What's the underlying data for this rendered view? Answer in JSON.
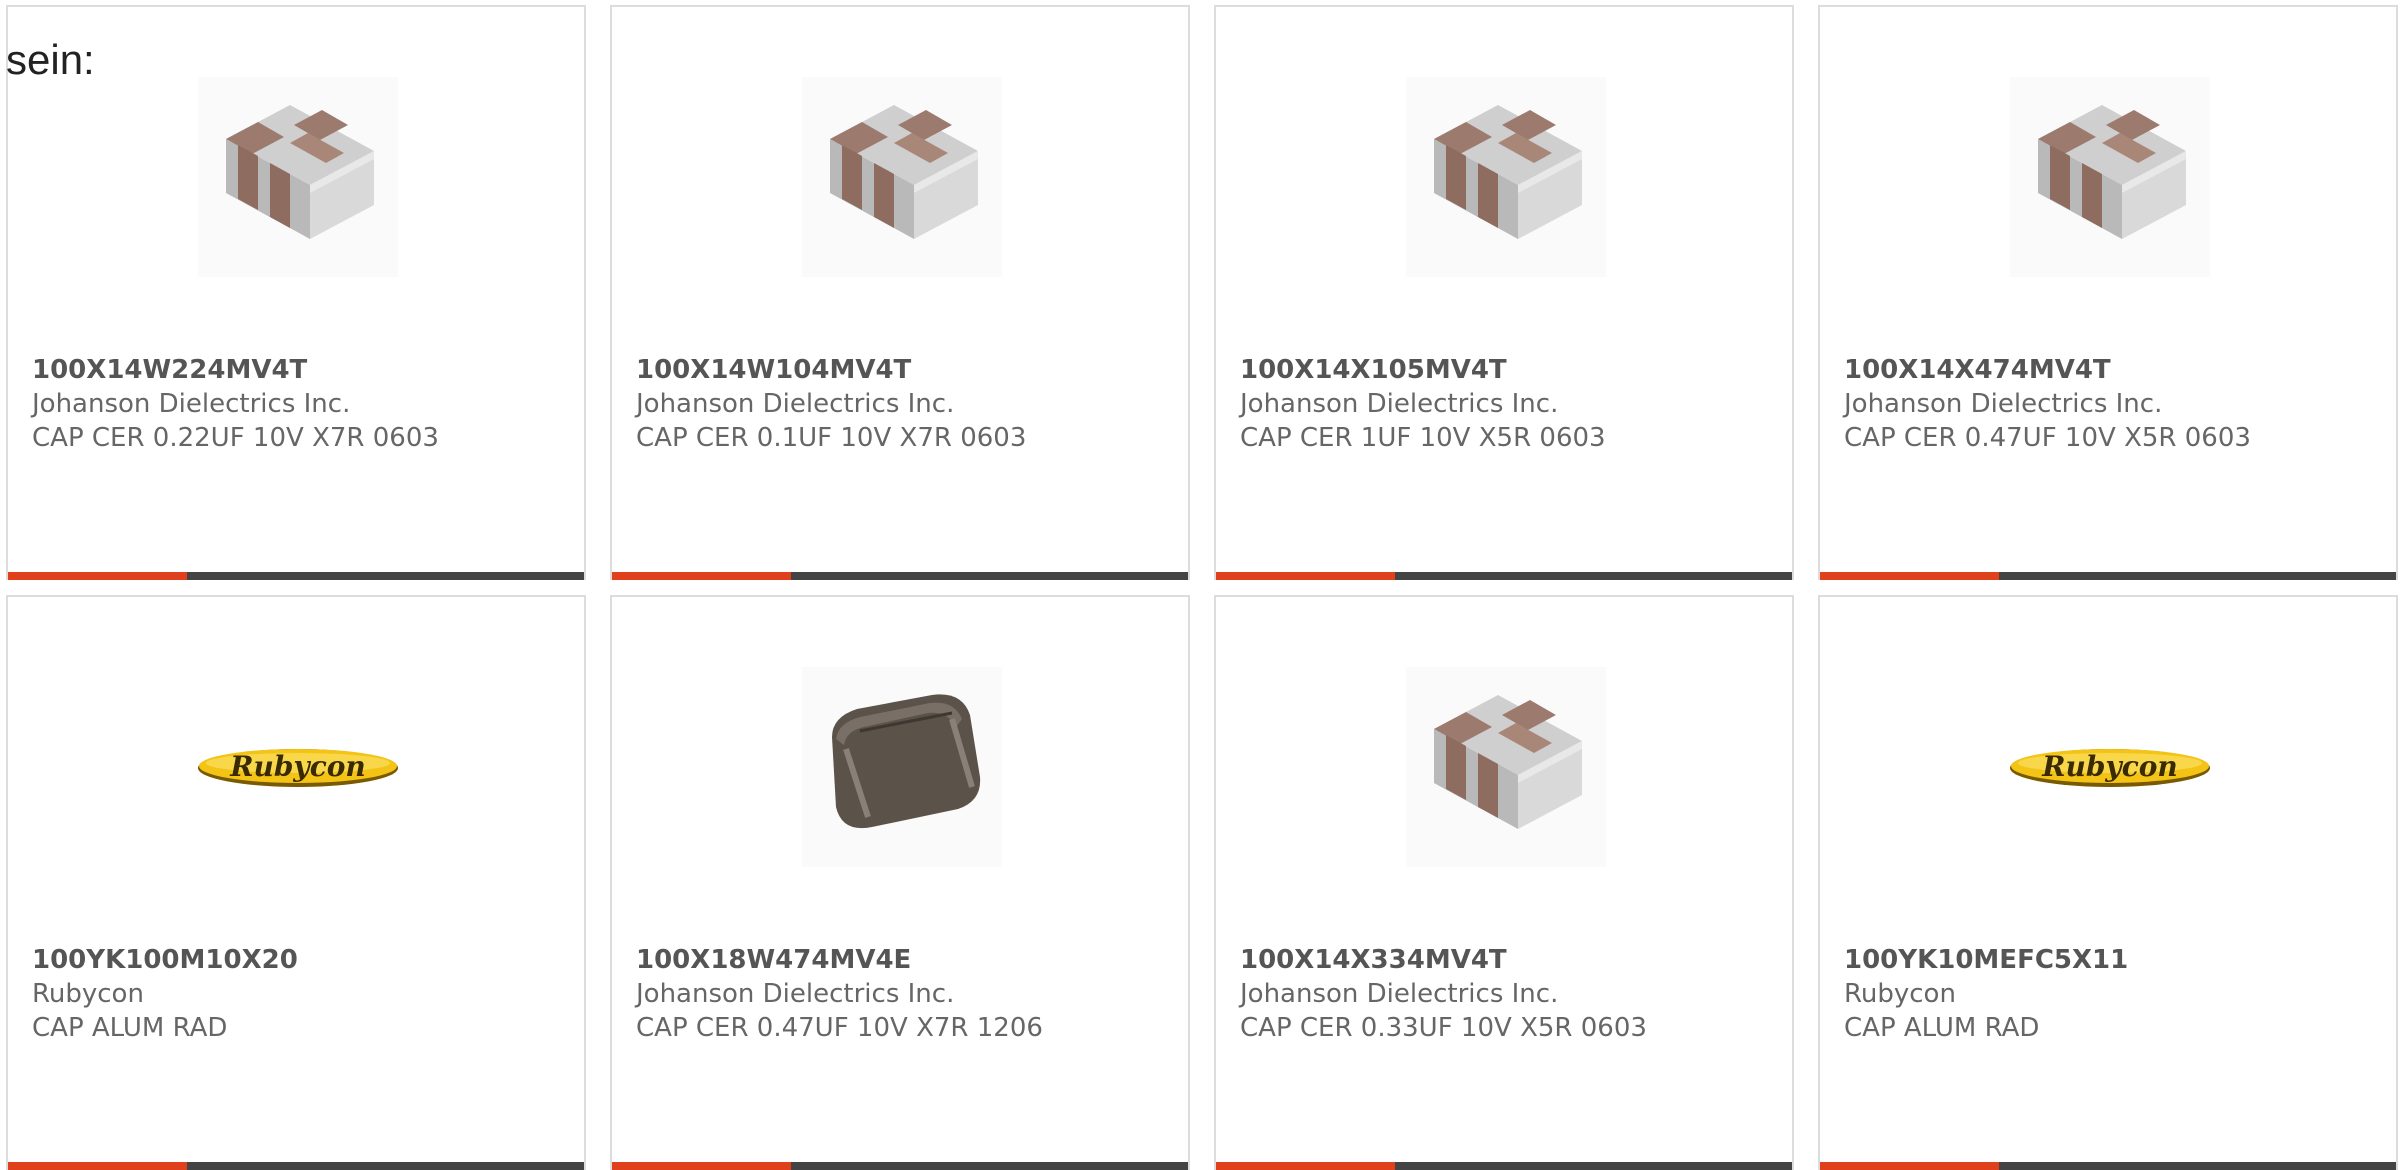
{
  "intro_text": "sein:",
  "colors": {
    "accent": "#e0401c",
    "bar_dark": "#444444",
    "card_border": "#dcdcdc"
  },
  "products": [
    {
      "part": "100X14W224MV4T",
      "manufacturer": "Johanson Dielectrics Inc.",
      "description": "CAP CER 0.22UF 10V X7R 0603",
      "image": "ceramic-chip-capacitor-icon",
      "accent_fraction": 0.31
    },
    {
      "part": "100X14W104MV4T",
      "manufacturer": "Johanson Dielectrics Inc.",
      "description": "CAP CER 0.1UF 10V X7R 0603",
      "image": "ceramic-chip-capacitor-icon",
      "accent_fraction": 0.31
    },
    {
      "part": "100X14X105MV4T",
      "manufacturer": "Johanson Dielectrics Inc.",
      "description": "CAP CER 1UF 10V X5R 0603",
      "image": "ceramic-chip-capacitor-icon",
      "accent_fraction": 0.31
    },
    {
      "part": "100X14X474MV4T",
      "manufacturer": "Johanson Dielectrics Inc.",
      "description": "CAP CER 0.47UF 10V X5R 0603",
      "image": "ceramic-chip-capacitor-icon",
      "accent_fraction": 0.31
    },
    {
      "part": "100YK100M10X20",
      "manufacturer": "Rubycon",
      "description": "CAP ALUM RAD",
      "image": "rubycon-logo",
      "logo_text": "Rubycon",
      "accent_fraction": 0.31
    },
    {
      "part": "100X18W474MV4E",
      "manufacturer": "Johanson Dielectrics Inc.",
      "description": "CAP CER 0.47UF 10V X7R 1206",
      "image": "dark-chip-capacitor-icon",
      "accent_fraction": 0.31
    },
    {
      "part": "100X14X334MV4T",
      "manufacturer": "Johanson Dielectrics Inc.",
      "description": "CAP CER 0.33UF 10V X5R 0603",
      "image": "ceramic-chip-capacitor-icon",
      "accent_fraction": 0.31
    },
    {
      "part": "100YK10MEFC5X11",
      "manufacturer": "Rubycon",
      "description": "CAP ALUM RAD",
      "image": "rubycon-logo",
      "logo_text": "Rubycon",
      "accent_fraction": 0.31
    }
  ]
}
